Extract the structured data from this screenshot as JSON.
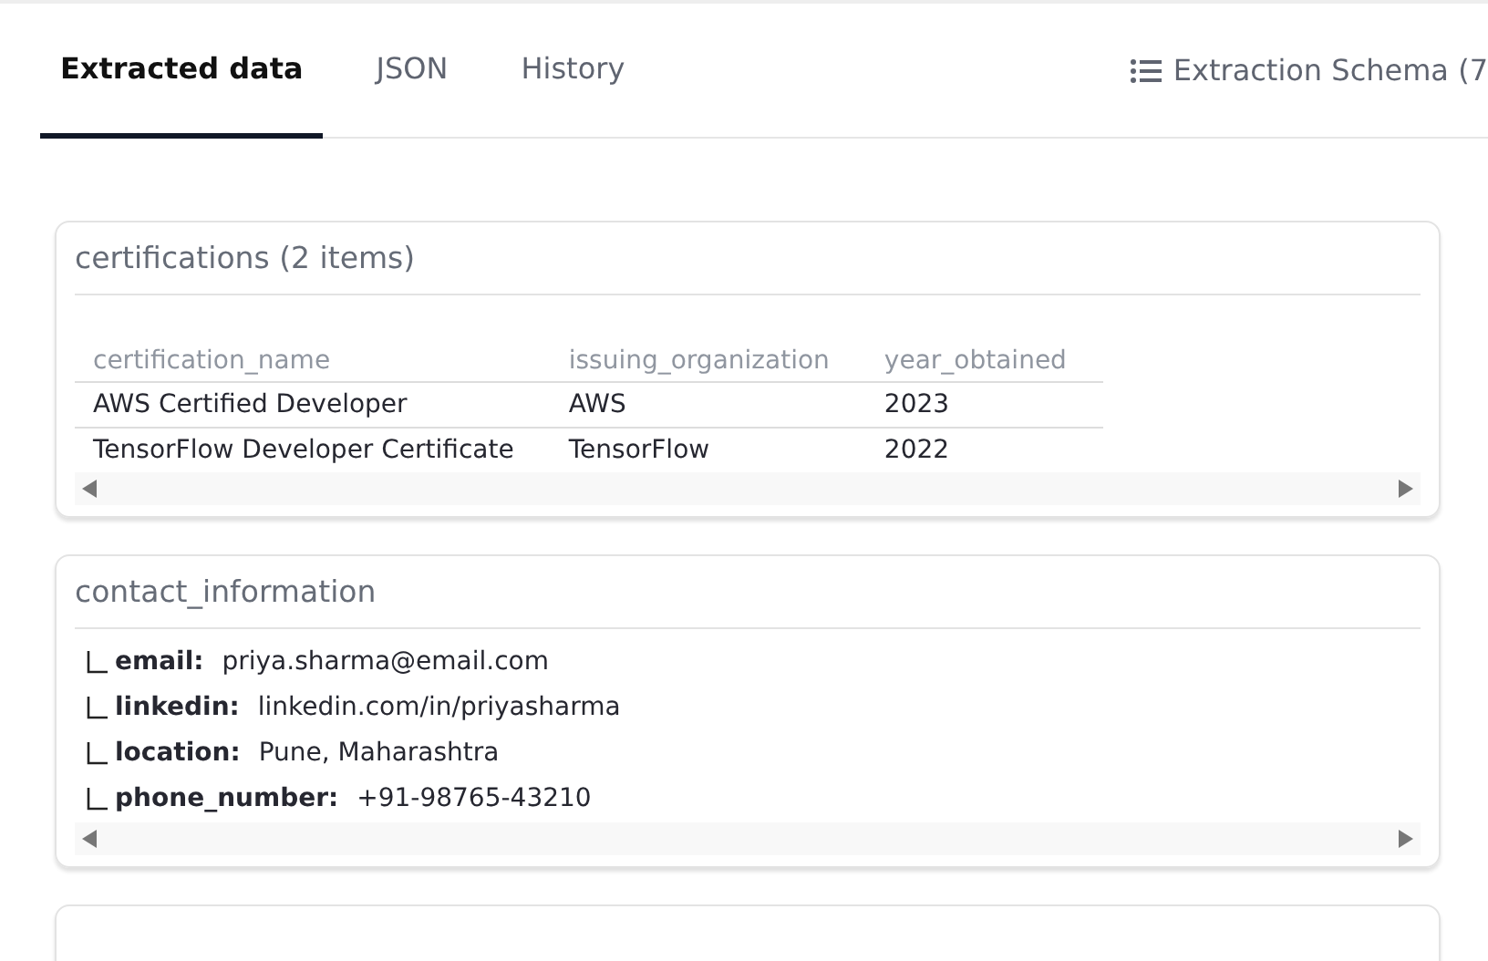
{
  "tabs": [
    {
      "label": "Extracted data",
      "selected": true
    },
    {
      "label": "JSON",
      "selected": false
    },
    {
      "label": "History",
      "selected": false
    }
  ],
  "schema_button": {
    "label": "Extraction Schema (7"
  },
  "sections": [
    {
      "kind": "table",
      "title": "certifications (2 items)",
      "columns": [
        "certification_name",
        "issuing_organization",
        "year_obtained"
      ],
      "rows": [
        [
          "AWS Certified Developer",
          "AWS",
          "2023"
        ],
        [
          "TensorFlow Developer Certificate",
          "TensorFlow",
          "2022"
        ]
      ]
    },
    {
      "kind": "fields",
      "title": "contact_information",
      "fields": [
        {
          "key": "email:",
          "value": "priya.sharma@email.com"
        },
        {
          "key": "linkedin:",
          "value": "linkedin.com/in/priyasharma"
        },
        {
          "key": "location:",
          "value": "Pune, Maharashtra"
        },
        {
          "key": "phone_number:",
          "value": "+91-98765-43210"
        }
      ]
    },
    {
      "kind": "empty"
    }
  ]
}
